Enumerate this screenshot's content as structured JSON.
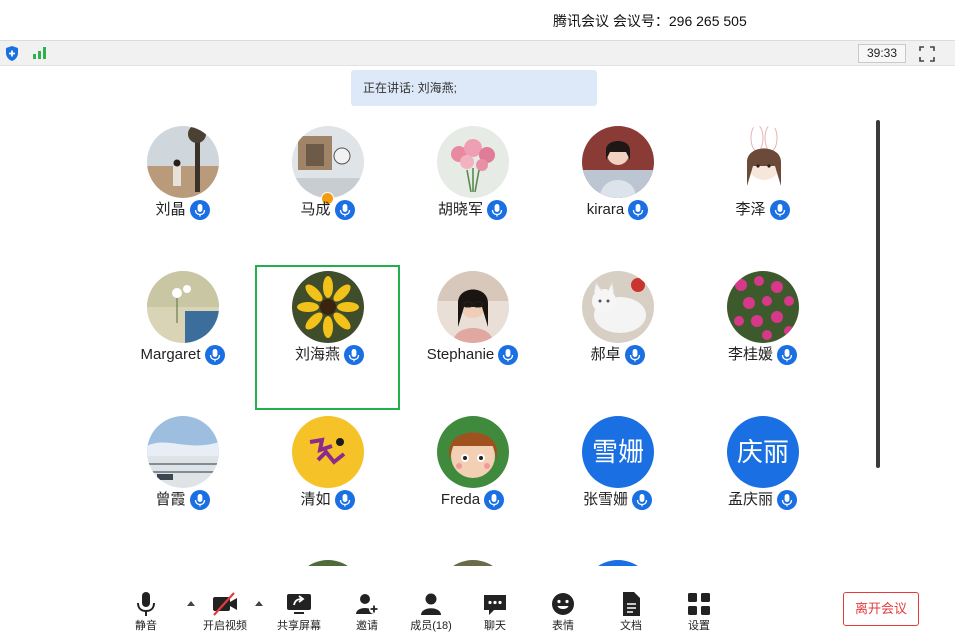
{
  "window": {
    "title": "腾讯会议 会议号：296 265 505"
  },
  "status": {
    "timer": "39:33"
  },
  "speaking": {
    "label": "正在讲话: 刘海燕;"
  },
  "participants": [
    {
      "name": "刘晶"
    },
    {
      "name": "马成"
    },
    {
      "name": "胡晓军"
    },
    {
      "name": "kirara"
    },
    {
      "name": "李泽"
    },
    {
      "name": "Margaret"
    },
    {
      "name": "刘海燕"
    },
    {
      "name": "Stephanie"
    },
    {
      "name": "郝卓"
    },
    {
      "name": "李桂媛"
    },
    {
      "name": "曾霞"
    },
    {
      "name": "清如"
    },
    {
      "name": "Freda"
    },
    {
      "name": "张雪姗",
      "avatar_text": "雪姗"
    },
    {
      "name": "孟庆丽",
      "avatar_text": "庆丽"
    }
  ],
  "toolbar": {
    "mute": "静音",
    "video": "开启视频",
    "share": "共享屏幕",
    "invite": "邀请",
    "members": "成员(18)",
    "chat": "聊天",
    "reactions": "表情",
    "docs": "文档",
    "settings": "设置",
    "leave": "离开会议"
  },
  "colors": {
    "accent_blue": "#1a6fe3",
    "active_speaker_border": "#21b04b",
    "leave_red": "#e53b3b",
    "speaking_banner": "#dde9f8"
  }
}
